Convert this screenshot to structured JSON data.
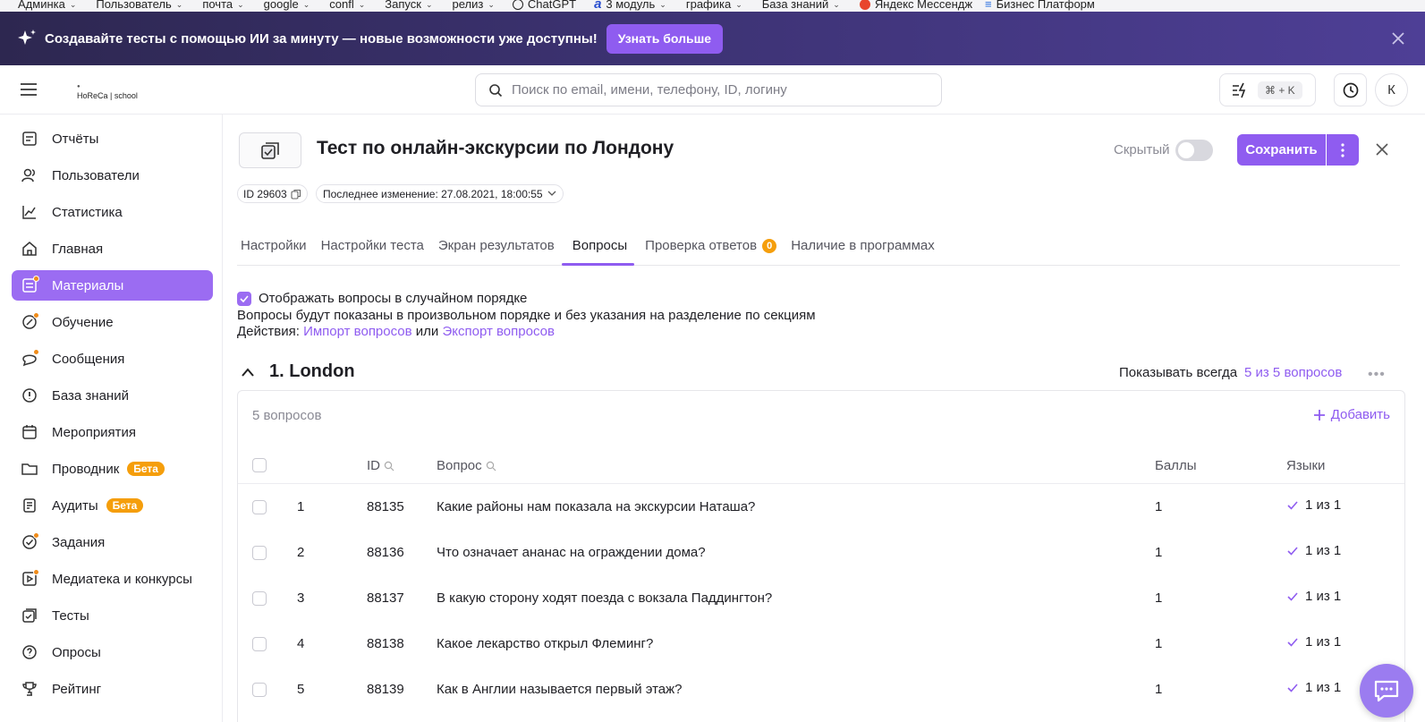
{
  "bookmarks": [
    {
      "label": "Админка",
      "has_menu": true
    },
    {
      "label": "Пользователь",
      "has_menu": true
    },
    {
      "label": "почта",
      "has_menu": true
    },
    {
      "label": "google",
      "has_menu": true
    },
    {
      "label": "confl",
      "has_menu": true
    },
    {
      "label": "Запуск",
      "has_menu": true
    },
    {
      "label": "релиз",
      "has_menu": true
    },
    {
      "label": "ChatGPT",
      "has_menu": false
    },
    {
      "label": "3 модуль",
      "has_menu": true
    },
    {
      "label": "графика",
      "has_menu": true
    },
    {
      "label": "База знаний",
      "has_menu": true
    },
    {
      "label": "Яндекс Мессендж",
      "has_menu": false
    },
    {
      "label": "Бизнес Платформ",
      "has_menu": false
    }
  ],
  "promo": {
    "text": "Создавайте тесты с помощью ИИ за минуту — новые возможности уже доступны!",
    "button": "Узнать больше"
  },
  "topbar": {
    "logo_top": "HoReCa | school",
    "search_placeholder": "Поиск по email, имени, телефону, ID, логину",
    "shortcut": "⌘ + K",
    "avatar_letter": "К"
  },
  "sidebar": {
    "items": [
      {
        "label": "Отчёты",
        "icon": "reports-icon",
        "dot": false,
        "active": false,
        "badge": ""
      },
      {
        "label": "Пользователи",
        "icon": "users-icon",
        "dot": false,
        "active": false,
        "badge": ""
      },
      {
        "label": "Статистика",
        "icon": "stats-icon",
        "dot": false,
        "active": false,
        "badge": ""
      },
      {
        "label": "Главная",
        "icon": "home-icon",
        "dot": false,
        "active": false,
        "badge": ""
      },
      {
        "label": "Материалы",
        "icon": "materials-icon",
        "dot": true,
        "active": true,
        "badge": ""
      },
      {
        "label": "Обучение",
        "icon": "learning-icon",
        "dot": true,
        "active": false,
        "badge": ""
      },
      {
        "label": "Сообщения",
        "icon": "messages-icon",
        "dot": true,
        "active": false,
        "badge": ""
      },
      {
        "label": "База знаний",
        "icon": "knowledge-icon",
        "dot": false,
        "active": false,
        "badge": ""
      },
      {
        "label": "Мероприятия",
        "icon": "calendar-icon",
        "dot": false,
        "active": false,
        "badge": ""
      },
      {
        "label": "Проводник",
        "icon": "folder-icon",
        "dot": false,
        "active": false,
        "badge": "Бета"
      },
      {
        "label": "Аудиты",
        "icon": "audit-icon",
        "dot": false,
        "active": false,
        "badge": "Бета"
      },
      {
        "label": "Задания",
        "icon": "tasks-icon",
        "dot": true,
        "active": false,
        "badge": ""
      },
      {
        "label": "Медиатека и конкурсы",
        "icon": "media-icon",
        "dot": true,
        "active": false,
        "badge": ""
      },
      {
        "label": "Тесты",
        "icon": "tests-icon",
        "dot": false,
        "active": false,
        "badge": ""
      },
      {
        "label": "Опросы",
        "icon": "polls-icon",
        "dot": false,
        "active": false,
        "badge": ""
      },
      {
        "label": "Рейтинг",
        "icon": "trophy-icon",
        "dot": false,
        "active": false,
        "badge": ""
      }
    ]
  },
  "header": {
    "title": "Тест по онлайн-экскурсии по Лондону",
    "hidden_label": "Скрытый",
    "hidden_on": false,
    "save_label": "Сохранить",
    "id_label": "ID 29603",
    "last_modified": "Последнее изменение: 27.08.2021, 18:00:55"
  },
  "tabs": [
    {
      "label": "Настройки",
      "active": false,
      "count": ""
    },
    {
      "label": "Настройки теста",
      "active": false,
      "count": ""
    },
    {
      "label": "Экран результатов",
      "active": false,
      "count": ""
    },
    {
      "label": "Вопросы",
      "active": true,
      "count": ""
    },
    {
      "label": "Проверка ответов",
      "active": false,
      "count": "0"
    },
    {
      "label": "Наличие в программах",
      "active": false,
      "count": ""
    }
  ],
  "questions_settings": {
    "random_order_label": "Отображать вопросы в случайном порядке",
    "random_order_checked": true,
    "description": "Вопросы будут показаны в произвольном порядке и без указания на разделение по секциям",
    "actions_prefix": "Действия:",
    "import_link": "Импорт вопросов",
    "or_word": "или",
    "export_link": "Экспорт вопросов"
  },
  "section": {
    "title": "1. London",
    "show_mode": "Показывать всегда",
    "count_link": "5 из 5 вопросов",
    "questions_count": "5 вопросов",
    "add_label": "Добавить",
    "columns": {
      "id": "ID",
      "question": "Вопрос",
      "points": "Баллы",
      "languages": "Языки"
    },
    "rows": [
      {
        "num": "1",
        "id": "88135",
        "question": "Какие районы нам показала на экскурсии Наташа?",
        "points": "1",
        "languages": "1 из 1"
      },
      {
        "num": "2",
        "id": "88136",
        "question": "Что означает ананас на ограждении дома?",
        "points": "1",
        "languages": "1 из 1"
      },
      {
        "num": "3",
        "id": "88137",
        "question": "В какую сторону ходят поезда с вокзала Паддингтон?",
        "points": "1",
        "languages": "1 из 1"
      },
      {
        "num": "4",
        "id": "88138",
        "question": "Какое лекарство открыл Флеминг?",
        "points": "1",
        "languages": "1 из 1"
      },
      {
        "num": "5",
        "id": "88139",
        "question": "Как в Англии называется первый этаж?",
        "points": "1",
        "languages": "1 из 1"
      }
    ]
  },
  "colors": {
    "accent": "#8f5cf0",
    "badge": "#f59e0b",
    "banner": "#3c3272"
  }
}
